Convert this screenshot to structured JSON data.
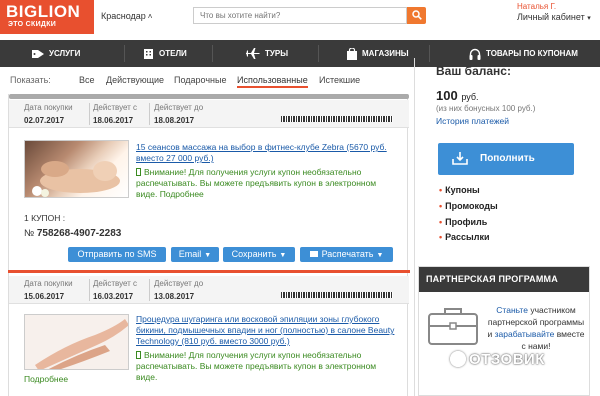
{
  "header": {
    "logo_main": "BIGLION",
    "logo_sub": "ЭТО СКИДКИ",
    "city": "Краснодар",
    "search_placeholder": "Что вы хотите найти?",
    "user_name": "Наталья Г.",
    "cabinet_label": "Личный кабинет"
  },
  "nav": {
    "items": [
      {
        "label": "УСЛУГИ",
        "icon": "tag-icon"
      },
      {
        "label": "ОТЕЛИ",
        "icon": "hotel-icon"
      },
      {
        "label": "ТУРЫ",
        "icon": "plane-icon"
      },
      {
        "label": "МАГАЗИНЫ",
        "icon": "shopping-bag-icon"
      },
      {
        "label": "ТОВАРЫ ПО КУПОНАМ",
        "icon": "headphones-icon"
      }
    ]
  },
  "filters": {
    "label": "Показать:",
    "options": [
      "Все",
      "Действующие",
      "Подарочные",
      "Использованные",
      "Истекшие"
    ],
    "active": "Использованные"
  },
  "coupons": [
    {
      "purchase_label": "Дата покупки",
      "purchase_date": "02.07.2017",
      "valid_from_label": "Действует с",
      "valid_from": "18.06.2017",
      "valid_to_label": "Действует до",
      "valid_to": "18.08.2017",
      "title": "15 сеансов массажа на выбор в фитнес-клубе Zebra (5670 руб. вместо 27 000 руб.)",
      "warning": "Внимание! Для получения услуги купон необязательно распечатывать. Вы можете предъявить купон в электронном виде.",
      "more_link": "Подробнее",
      "qty_label": "1 КУПОН :",
      "number_prefix": "№",
      "number": "758268-4907-2283",
      "buttons": {
        "sms": "Отправить по SMS",
        "email": "Email",
        "save": "Сохранить",
        "print": "Распечатать"
      }
    },
    {
      "purchase_label": "Дата покупки",
      "purchase_date": "15.06.2017",
      "valid_from_label": "Действует с",
      "valid_from": "16.03.2017",
      "valid_to_label": "Действует до",
      "valid_to": "13.08.2017",
      "title": "Процедура шугаринга или восковой эпиляции зоны глубокого бикини, подмышечных впадин и ног (полностью) в салоне Beauty Technology (810 руб. вместо 3000 руб.)",
      "warning": "Внимание! Для получения услуги купон необязательно распечатывать. Вы можете предъявить купон в электронном виде.",
      "more_link": "Подробнее"
    }
  ],
  "balance": {
    "title": "Ваш баланс:",
    "amount": "100",
    "currency": "руб.",
    "bonus_note": "(из них бонусных 100 руб.)",
    "history_link": "История платежей",
    "topup_button": "Пополнить"
  },
  "side_menu": [
    "Купоны",
    "Промокоды",
    "Профиль",
    "Рассылки"
  ],
  "partner": {
    "title": "ПАРТНЕРСКАЯ ПРОГРАММА",
    "link1": "Станьте",
    "text1": "участником партнерской программы и",
    "link2": "зарабатывайте",
    "text2": "вместе с нами!"
  },
  "watermark": "ОТЗОВИК",
  "colors": {
    "brand": "#e8502f",
    "nav_bg": "#3a3a3a",
    "button_blue": "#3d8fd6",
    "warning_green": "#3a8a20"
  }
}
